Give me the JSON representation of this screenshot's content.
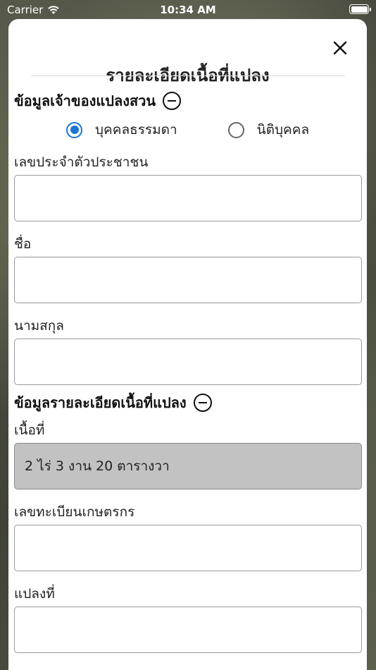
{
  "status_bar": {
    "carrier": "Carrier",
    "time": "10:34 AM"
  },
  "sheet": {
    "title": "รายละเอียดเนื้อที่แปลง",
    "close_icon": "close-icon"
  },
  "owner_section": {
    "title": "ข้อมูลเจ้าของแปลงสวน",
    "owner_type_options": [
      {
        "label": "บุคคลธรรมดา",
        "selected": true
      },
      {
        "label": "นิติบุคคล",
        "selected": false
      }
    ],
    "fields": {
      "id_number_label": "เลขประจำตัวประชาชน",
      "id_number_value": "",
      "first_name_label": "ชื่อ",
      "first_name_value": "",
      "last_name_label": "นามสกุล",
      "last_name_value": ""
    }
  },
  "plot_section": {
    "title": "ข้อมูลรายละเอียดเนื้อที่แปลง",
    "fields": {
      "area_label": "เนื้อที่",
      "area_value": "2 ไร่ 3 งาน 20 ตารางวา",
      "farmer_reg_label": "เลขทะเบียนเกษตรกร",
      "farmer_reg_value": "",
      "plot_no_label": "แปลงที่",
      "plot_no_value": ""
    }
  },
  "colors": {
    "accent": "#1976d2",
    "disabled_field": "#c2c2c2"
  }
}
